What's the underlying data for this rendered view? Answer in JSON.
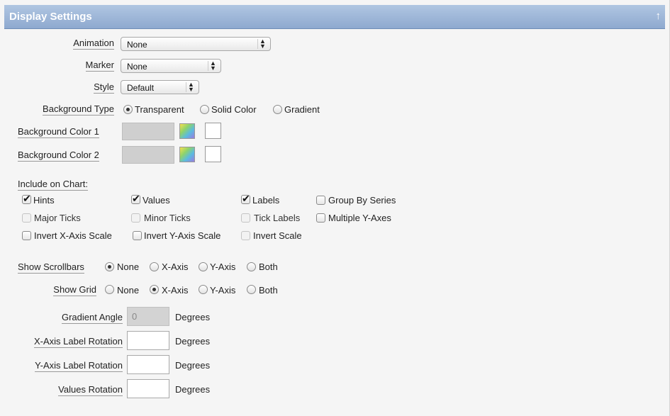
{
  "header": {
    "title": "Display Settings",
    "collapse_icon": "↑"
  },
  "animation": {
    "label": "Animation",
    "value": "None"
  },
  "marker": {
    "label": "Marker",
    "value": "None"
  },
  "style": {
    "label": "Style",
    "value": "Default"
  },
  "background_type": {
    "label": "Background Type",
    "options": [
      "Transparent",
      "Solid Color",
      "Gradient"
    ],
    "selected": "Transparent"
  },
  "background_color_1": {
    "label": "Background Color 1"
  },
  "background_color_2": {
    "label": "Background Color 2"
  },
  "include": {
    "label": "Include on Chart:",
    "items": [
      {
        "label": "Hints",
        "checked": true,
        "enabled": true
      },
      {
        "label": "Values",
        "checked": true,
        "enabled": true
      },
      {
        "label": "Labels",
        "checked": true,
        "enabled": true
      },
      {
        "label": "Group By Series",
        "checked": false,
        "enabled": true
      },
      {
        "label": "Major Ticks",
        "checked": false,
        "enabled": false
      },
      {
        "label": "Minor Ticks",
        "checked": false,
        "enabled": false
      },
      {
        "label": "Tick Labels",
        "checked": false,
        "enabled": false
      },
      {
        "label": "Multiple Y-Axes",
        "checked": false,
        "enabled": true
      },
      {
        "label": "Invert X-Axis Scale",
        "checked": false,
        "enabled": true
      },
      {
        "label": "Invert Y-Axis Scale",
        "checked": false,
        "enabled": true
      },
      {
        "label": "Invert Scale",
        "checked": false,
        "enabled": false
      }
    ]
  },
  "show_scrollbars": {
    "label": "Show Scrollbars",
    "options": [
      "None",
      "X-Axis",
      "Y-Axis",
      "Both"
    ],
    "selected": "None"
  },
  "show_grid": {
    "label": "Show Grid",
    "options": [
      "None",
      "X-Axis",
      "Y-Axis",
      "Both"
    ],
    "selected": "X-Axis"
  },
  "gradient_angle": {
    "label": "Gradient Angle",
    "value": "0",
    "unit": "Degrees"
  },
  "x_axis_label_rotation": {
    "label": "X-Axis Label Rotation",
    "value": "",
    "unit": "Degrees"
  },
  "y_axis_label_rotation": {
    "label": "Y-Axis Label Rotation",
    "value": "",
    "unit": "Degrees"
  },
  "values_rotation": {
    "label": "Values Rotation",
    "value": "",
    "unit": "Degrees"
  }
}
